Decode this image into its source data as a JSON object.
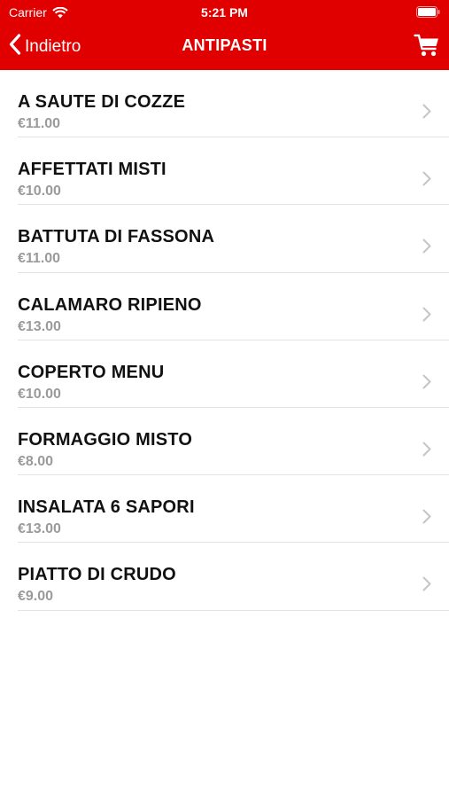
{
  "status_bar": {
    "carrier": "Carrier",
    "time": "5:21 PM",
    "icons": [
      "wifi-icon",
      "battery-icon"
    ]
  },
  "nav": {
    "back_label": "Indietro",
    "title": "ANTIPASTI",
    "icons": [
      "chevron-left-icon",
      "cart-icon"
    ]
  },
  "colors": {
    "accent": "#e10000",
    "price": "#9a9a9a",
    "separator": "#e3e3e3"
  },
  "items": [
    {
      "name": "A SAUTE DI COZZE",
      "price": "€11.00"
    },
    {
      "name": "AFFETTATI MISTI",
      "price": "€10.00"
    },
    {
      "name": "BATTUTA DI FASSONA",
      "price": "€11.00"
    },
    {
      "name": "CALAMARO RIPIENO",
      "price": "€13.00"
    },
    {
      "name": "COPERTO MENU",
      "price": "€10.00"
    },
    {
      "name": "FORMAGGIO MISTO",
      "price": "€8.00"
    },
    {
      "name": "INSALATA 6 SAPORI",
      "price": "€13.00"
    },
    {
      "name": "PIATTO DI CRUDO",
      "price": "€9.00"
    }
  ]
}
